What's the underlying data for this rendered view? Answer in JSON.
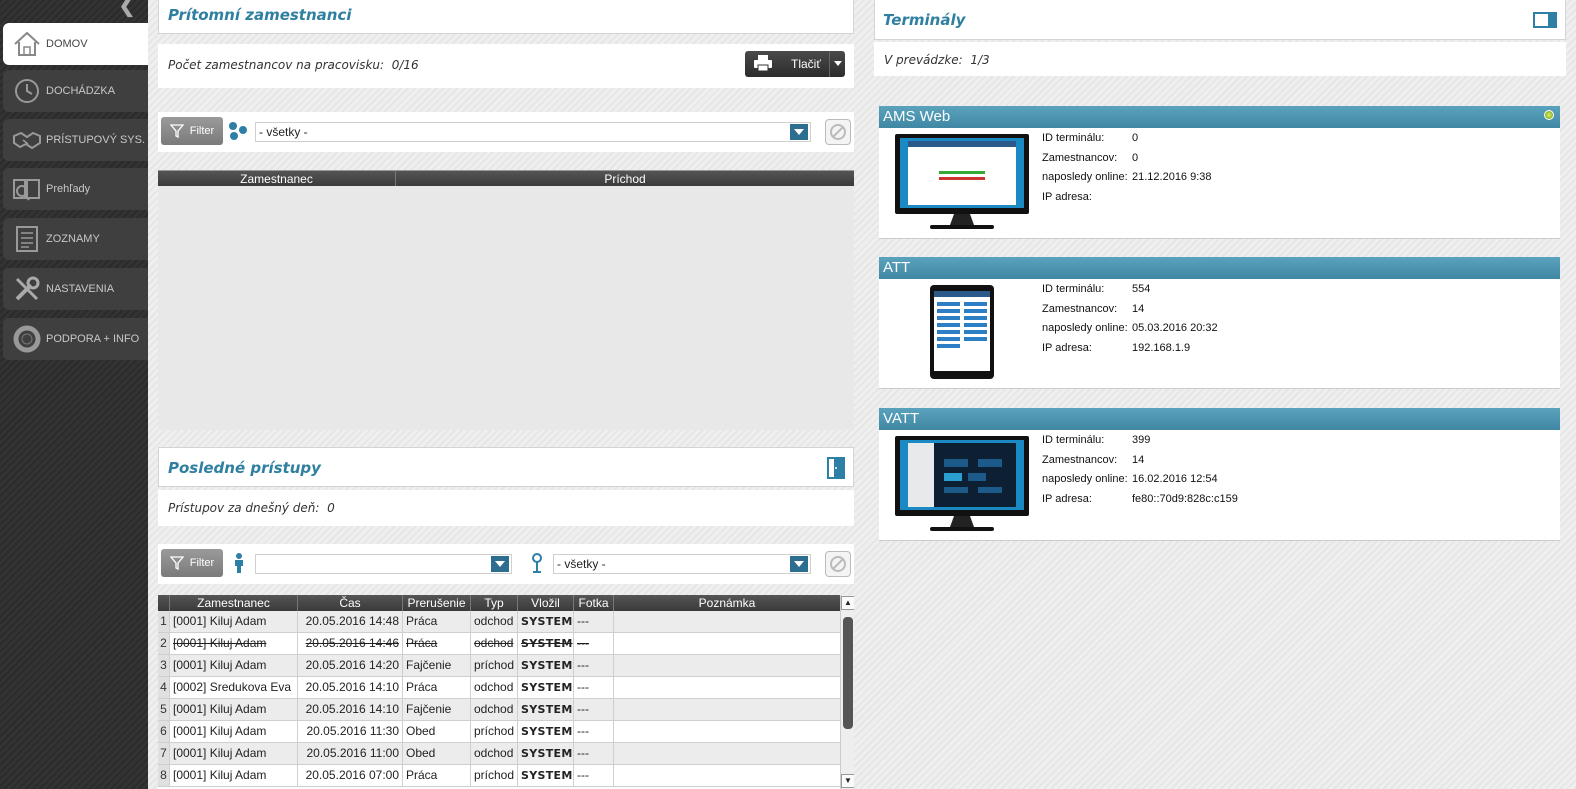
{
  "sidebar": {
    "items": [
      {
        "label": "DOMOV",
        "icon": "home-icon",
        "active": true
      },
      {
        "label": "DOCHÁDZKA",
        "icon": "clock-icon"
      },
      {
        "label": "PRÍSTUPOVÝ SYS.",
        "icon": "handshake-icon"
      },
      {
        "label": "Prehľady",
        "icon": "book-search-icon"
      },
      {
        "label": "ZOZNAMY",
        "icon": "list-icon"
      },
      {
        "label": "NASTAVENIA",
        "icon": "tools-icon"
      },
      {
        "label": "PODPORA + INFO",
        "icon": "lifebuoy-icon"
      }
    ]
  },
  "present": {
    "title": "Prítomní zamestnanci",
    "count_label": "Počet zamestnancov na pracovisku:",
    "count_value": "0/16",
    "print_label": "Tlačiť",
    "filter_label": "Filter",
    "group_select": "- všetky -",
    "columns": [
      "Zamestnanec",
      "Príchod"
    ]
  },
  "accesses": {
    "title": "Posledné prístupy",
    "count_label": "Prístupov za dnešný deň:",
    "count_value": "0",
    "filter_label": "Filter",
    "person_select": "",
    "location_select": "- všetky -",
    "columns": [
      "Zamestnanec",
      "Čas",
      "Prerušenie",
      "Typ",
      "Vložil",
      "Fotka",
      "Poznámka"
    ],
    "rows": [
      {
        "n": "1",
        "employee": "[0001] Kiluj Adam",
        "time": "20.05.2016 14:48",
        "break": "Práca",
        "type": "odchod",
        "by": "SYSTEM",
        "photo": "---",
        "note": "",
        "struck": false
      },
      {
        "n": "2",
        "employee": "[0001] Kiluj Adam",
        "time": "20.05.2016 14:46",
        "break": "Práca",
        "type": "odchod",
        "by": "SYSTEM",
        "photo": "---",
        "note": "",
        "struck": true
      },
      {
        "n": "3",
        "employee": "[0001] Kiluj Adam",
        "time": "20.05.2016 14:20",
        "break": "Fajčenie",
        "type": "príchod",
        "by": "SYSTEM",
        "photo": "---",
        "note": "",
        "struck": false
      },
      {
        "n": "4",
        "employee": "[0002] Sredukova Eva",
        "time": "20.05.2016 14:10",
        "break": "Práca",
        "type": "odchod",
        "by": "SYSTEM",
        "photo": "---",
        "note": "",
        "struck": false
      },
      {
        "n": "5",
        "employee": "[0001] Kiluj Adam",
        "time": "20.05.2016 14:10",
        "break": "Fajčenie",
        "type": "odchod",
        "by": "SYSTEM",
        "photo": "---",
        "note": "",
        "struck": false
      },
      {
        "n": "6",
        "employee": "[0001] Kiluj Adam",
        "time": "20.05.2016 11:30",
        "break": "Obed",
        "type": "príchod",
        "by": "SYSTEM",
        "photo": "---",
        "note": "",
        "struck": false
      },
      {
        "n": "7",
        "employee": "[0001] Kiluj Adam",
        "time": "20.05.2016 11:00",
        "break": "Obed",
        "type": "odchod",
        "by": "SYSTEM",
        "photo": "---",
        "note": "",
        "struck": false
      },
      {
        "n": "8",
        "employee": "[0001] Kiluj Adam",
        "time": "20.05.2016 07:00",
        "break": "Práca",
        "type": "príchod",
        "by": "SYSTEM",
        "photo": "---",
        "note": "",
        "struck": false
      }
    ]
  },
  "terminals": {
    "title": "Terminály",
    "operating_label": "V prevádzke:",
    "operating_value": "1/3",
    "field_labels": {
      "id": "ID terminálu:",
      "employees": "Zamestnancov:",
      "last_online": "naposledy online:",
      "ip": "IP adresa:"
    },
    "items": [
      {
        "name": "AMS Web",
        "id": "0",
        "employees": "0",
        "last_online": "21.12.2016 9:38",
        "ip": "",
        "online": true,
        "device": "monitor"
      },
      {
        "name": "ATT",
        "id": "554",
        "employees": "14",
        "last_online": "05.03.2016 20:32",
        "ip": "192.168.1.9",
        "online": false,
        "device": "tablet"
      },
      {
        "name": "VATT",
        "id": "399",
        "employees": "14",
        "last_online": "16.02.2016 12:54",
        "ip": "fe80::70d9:828c:c159",
        "online": false,
        "device": "monitor"
      }
    ]
  },
  "colors": {
    "accent": "#2e7fa0",
    "terminal_header": "#4a91ad",
    "sidebar": "#2f2f2f"
  }
}
